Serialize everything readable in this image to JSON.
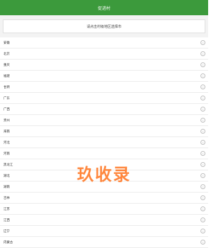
{
  "header": {
    "title": "促进村"
  },
  "select": {
    "placeholder": "请点击村级地区选择市"
  },
  "provinces": [
    "安徽",
    "北京",
    "重庆",
    "福建",
    "甘肃",
    "广东",
    "广西",
    "贵州",
    "海南",
    "河北",
    "河南",
    "黑龙江",
    "湖北",
    "湖南",
    "吉林",
    "江苏",
    "江西",
    "辽宁",
    "内蒙古"
  ],
  "chevron_icon": "chevron-right-icon",
  "watermark": {
    "text": "玖收录"
  },
  "colors": {
    "header_bg": "#3c9a3c",
    "watermark": "#ff7b2a"
  }
}
